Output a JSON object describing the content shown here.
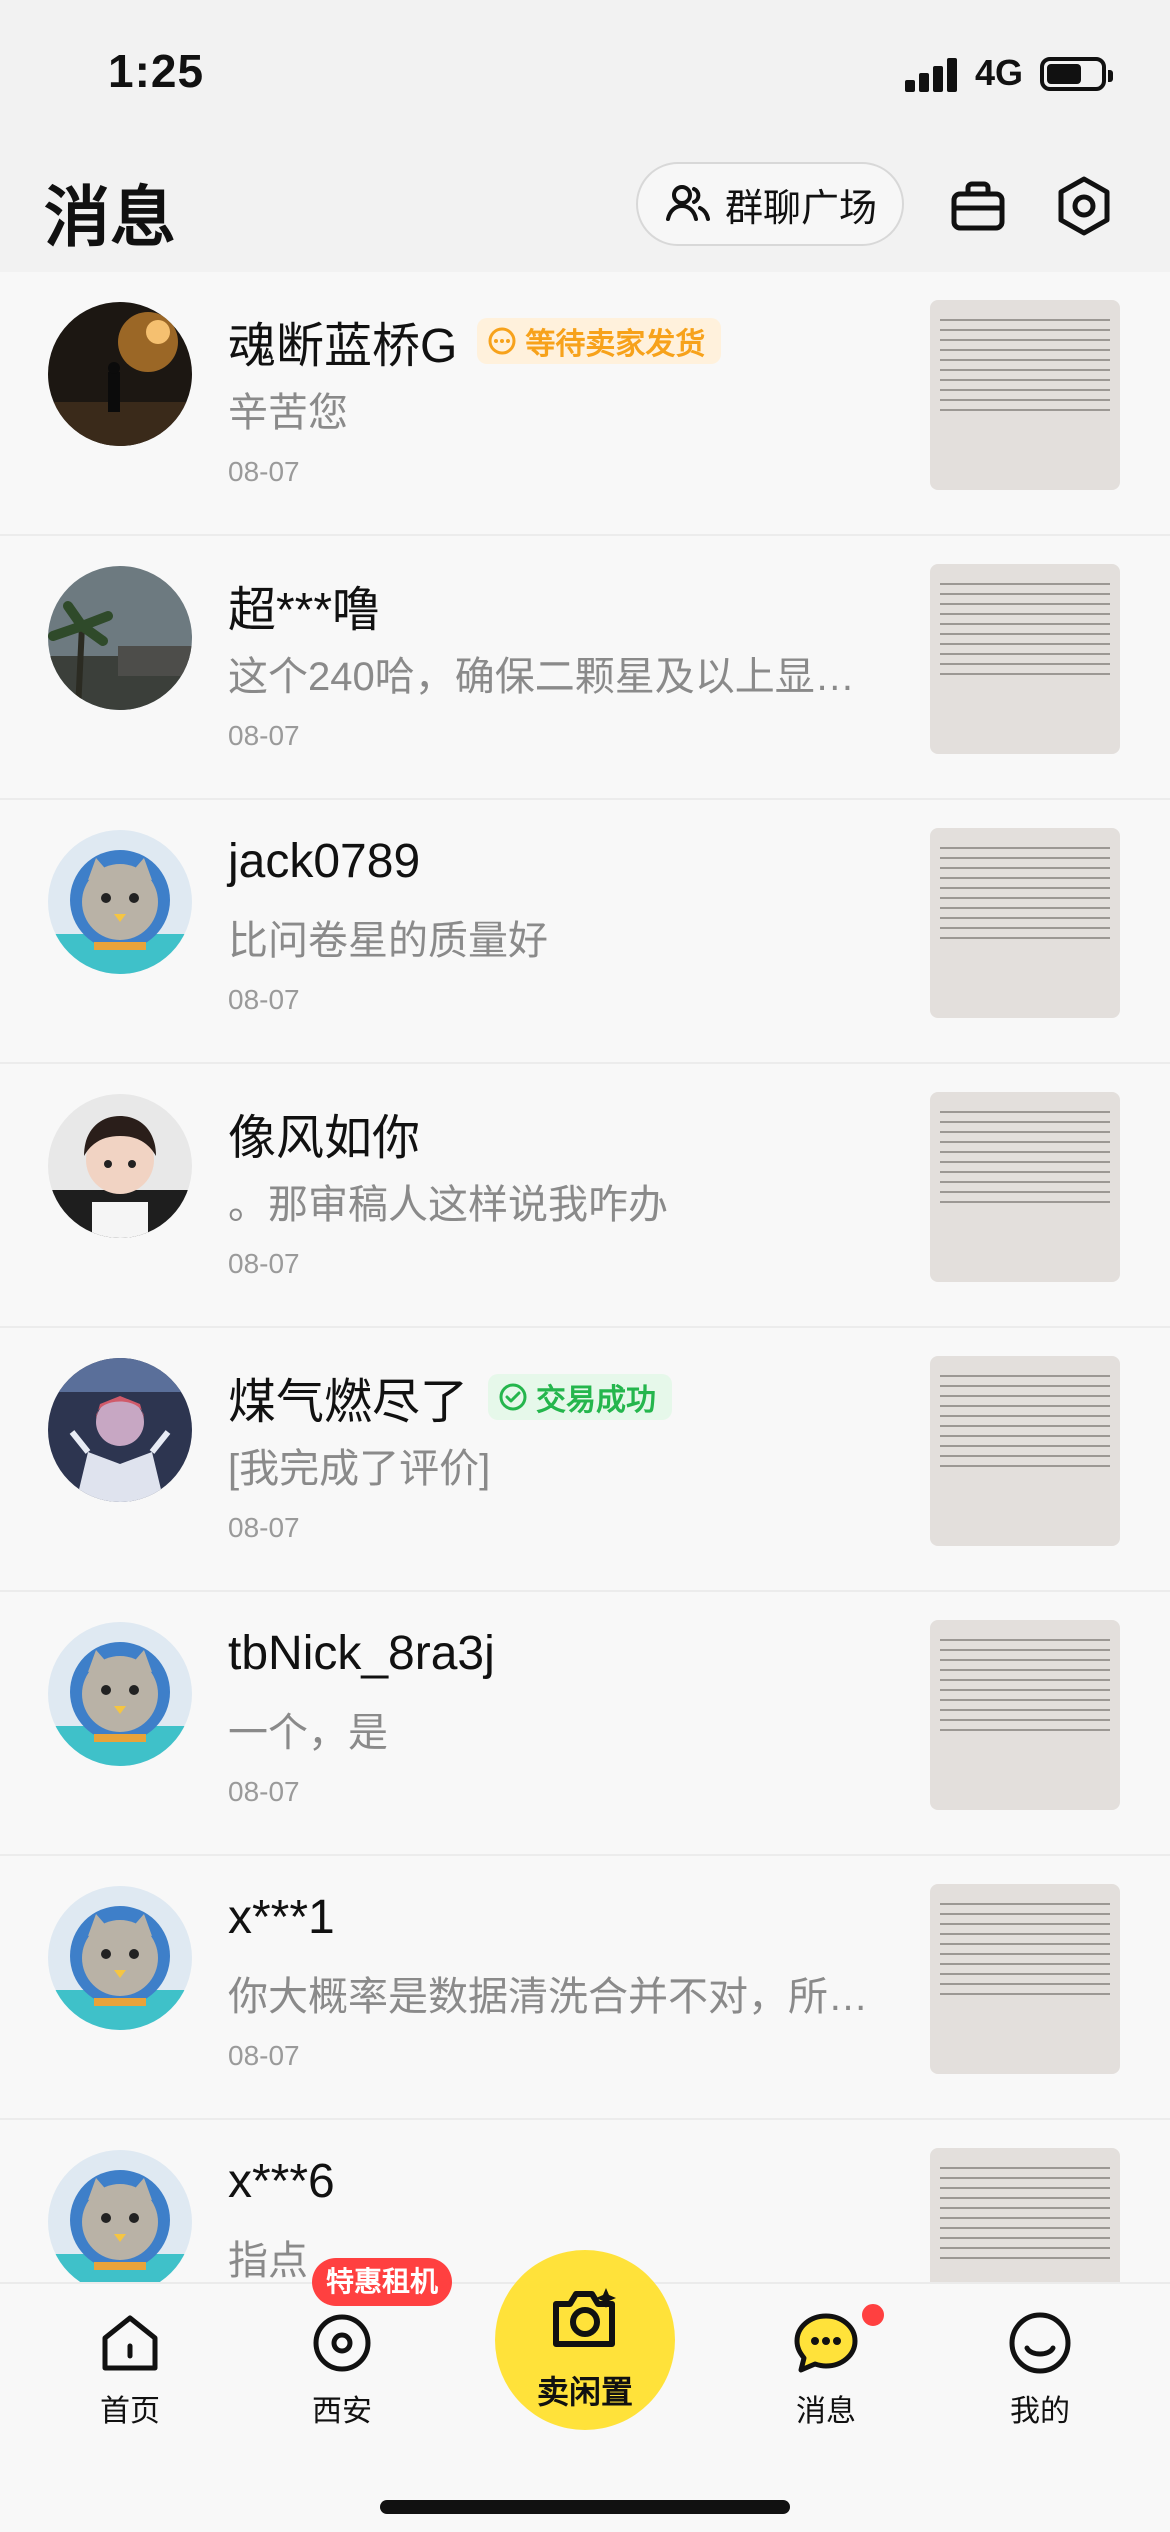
{
  "status_bar": {
    "time": "1:25",
    "network": "4G"
  },
  "header": {
    "title": "消息",
    "group_chat_label": "群聊广场",
    "icons": [
      "group-icon",
      "briefcase-icon",
      "settings-icon"
    ]
  },
  "messages": [
    {
      "name": "魂断蓝桥G",
      "badge": "等待卖家发货",
      "badge_type": "orange",
      "preview": "辛苦您",
      "date": "08-07",
      "avatar": "night-scene"
    },
    {
      "name": "超***噜",
      "badge": "",
      "preview": "这个240哈，确保二颗星及以上显…",
      "date": "08-07",
      "avatar": "palm-scene"
    },
    {
      "name": "jack0789",
      "badge": "",
      "preview": "比问卷星的质量好",
      "date": "08-07",
      "avatar": "default-cat"
    },
    {
      "name": "像风如你",
      "badge": "",
      "preview": "。那审稿人这样说我咋办",
      "date": "08-07",
      "avatar": "child-photo"
    },
    {
      "name": "煤气燃尽了",
      "badge": "交易成功",
      "badge_type": "green",
      "preview": "[我完成了评价]",
      "date": "08-07",
      "avatar": "anime"
    },
    {
      "name": "tbNick_8ra3j",
      "badge": "",
      "preview": "一个，是",
      "date": "08-07",
      "avatar": "default-cat"
    },
    {
      "name": "x***1",
      "badge": "",
      "preview": "你大概率是数据清洗合并不对，所…",
      "date": "08-07",
      "avatar": "default-cat"
    },
    {
      "name": "x***6",
      "badge": "",
      "preview": "指点",
      "date": "",
      "avatar": "default-cat"
    }
  ],
  "tabbar": {
    "tabs": [
      {
        "label": "首页",
        "icon": "home-icon"
      },
      {
        "label": "西安",
        "icon": "location-icon"
      },
      {
        "label": "卖闲置",
        "icon": "camera-icon"
      },
      {
        "label": "消息",
        "icon": "chat-icon"
      },
      {
        "label": "我的",
        "icon": "profile-icon"
      }
    ],
    "promo_badge": "特惠租机"
  },
  "colors": {
    "accent_yellow": "#ffe23a",
    "badge_orange": "#f7a21b",
    "badge_green": "#25b64d",
    "red_dot": "#ff4040"
  }
}
